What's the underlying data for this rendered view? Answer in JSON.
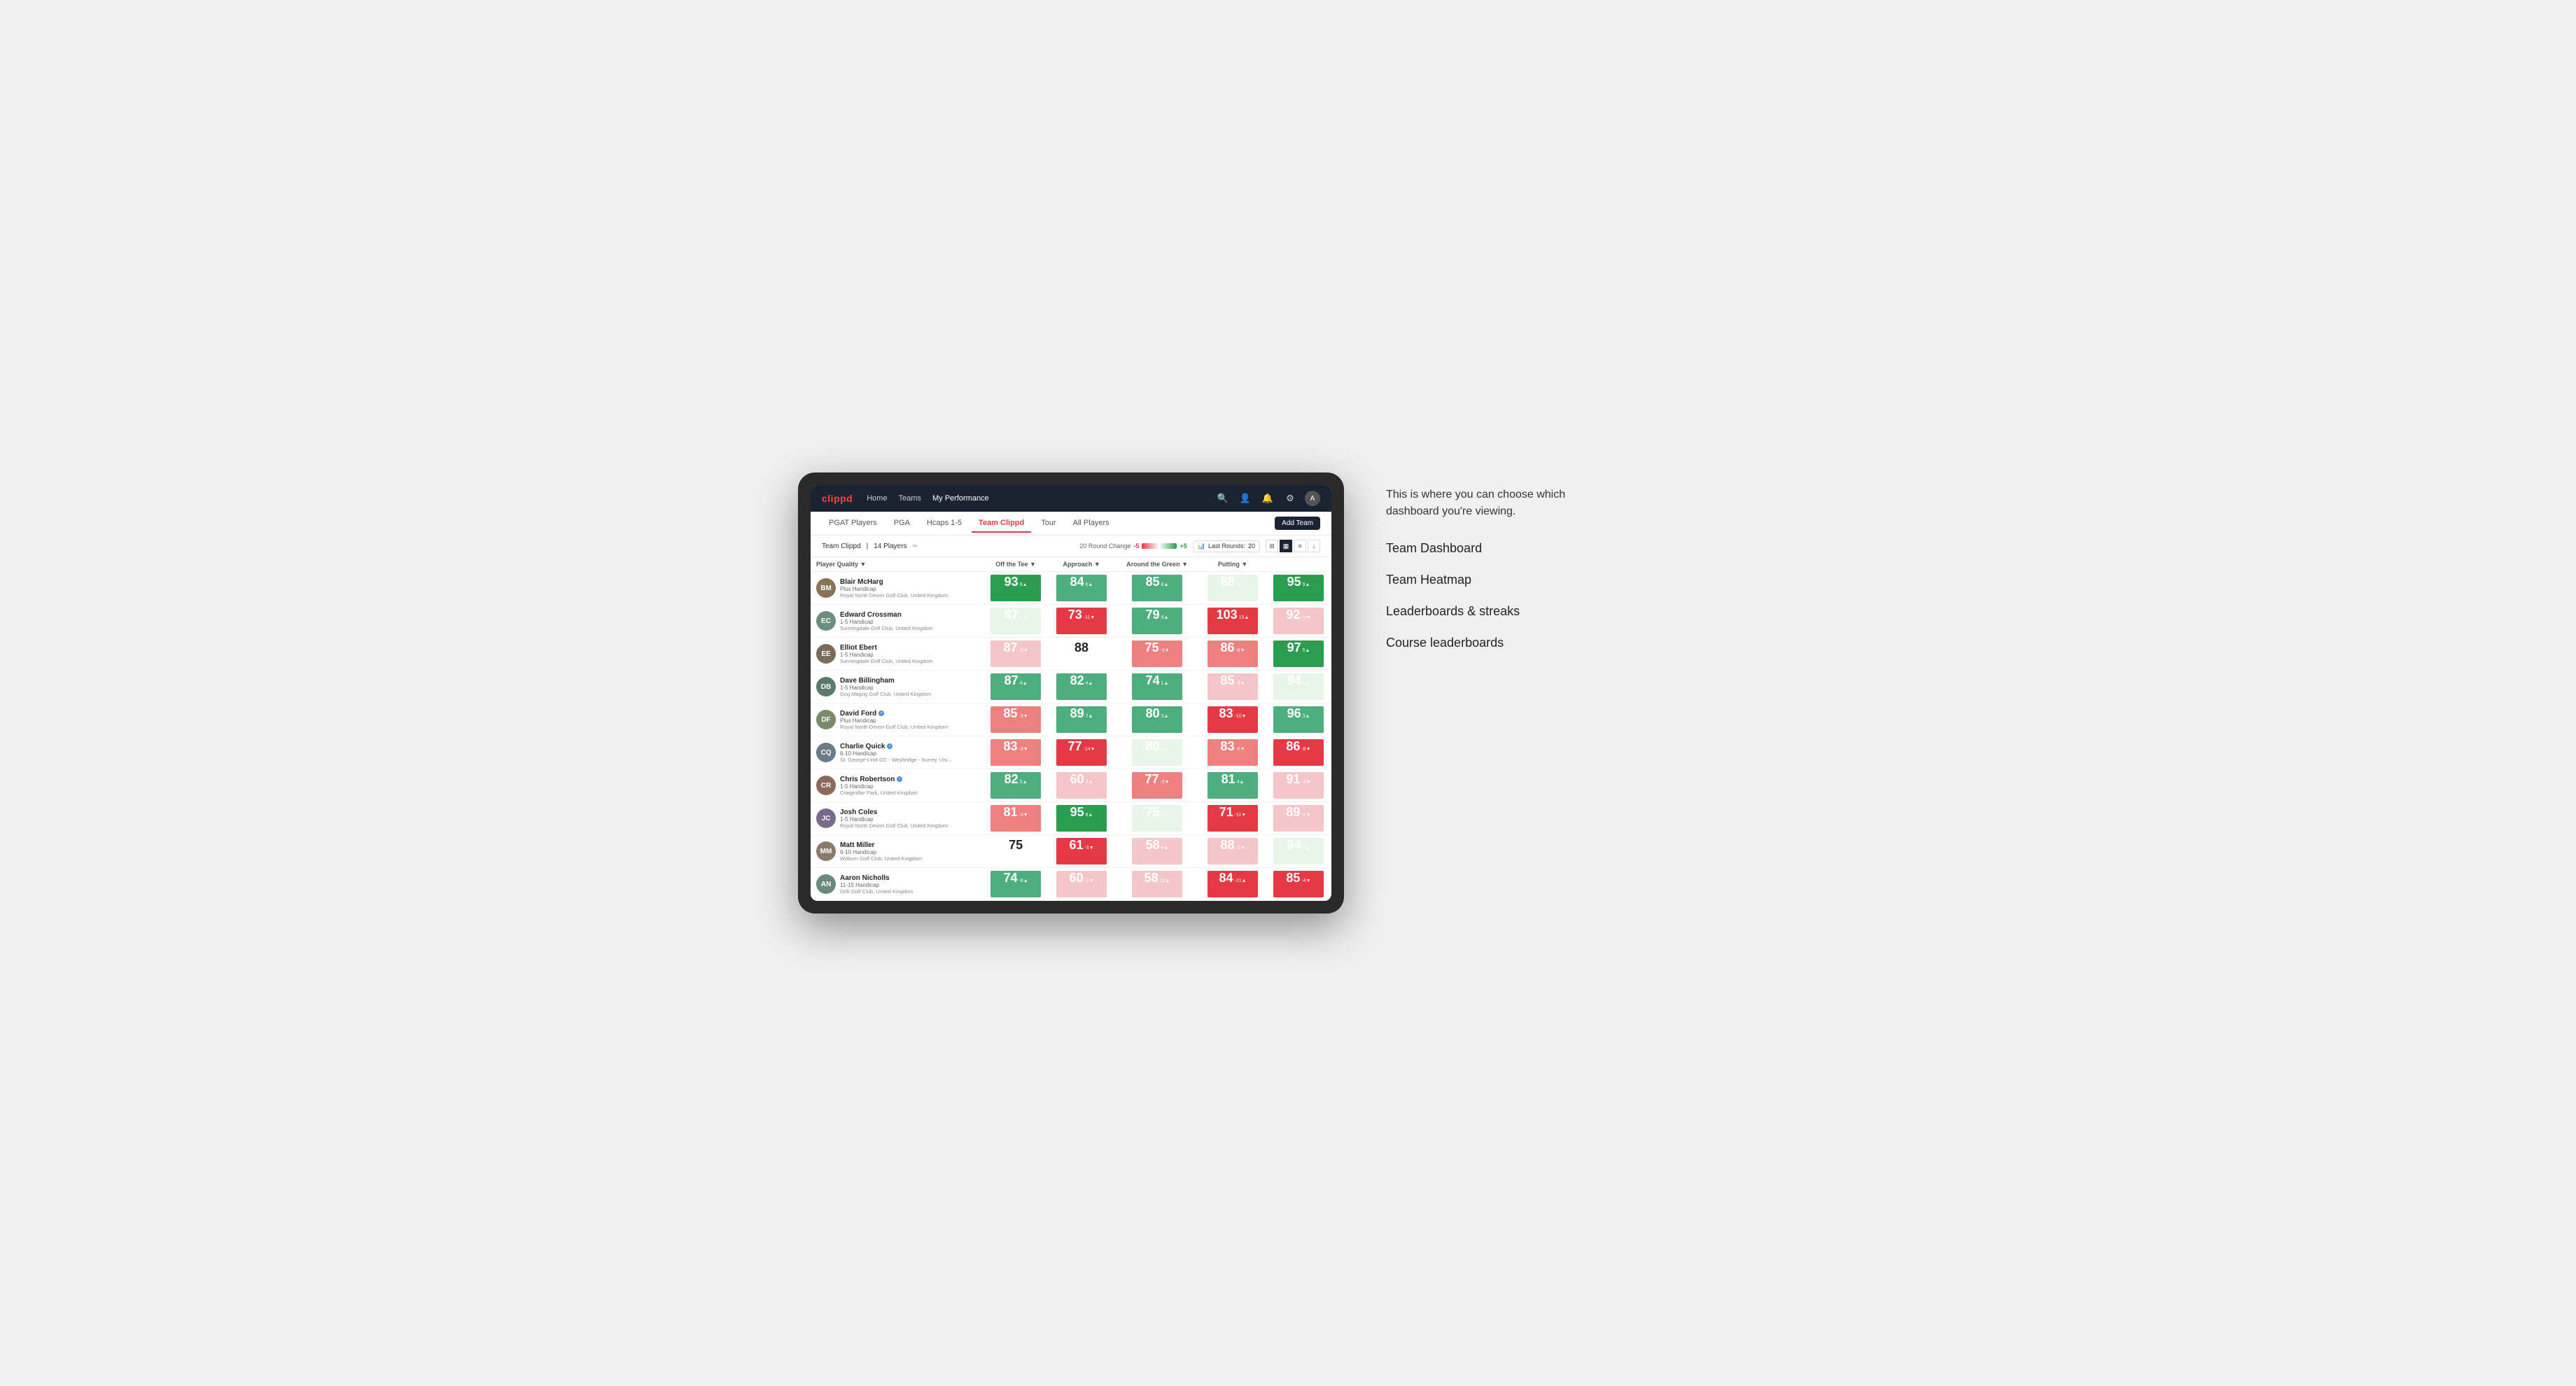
{
  "brand": "clippd",
  "navbar": {
    "links": [
      {
        "label": "Home",
        "active": false
      },
      {
        "label": "Teams",
        "active": false
      },
      {
        "label": "My Performance",
        "active": true
      }
    ],
    "icons": [
      "search",
      "person",
      "bell",
      "settings",
      "avatar"
    ]
  },
  "subnav": {
    "items": [
      {
        "label": "PGAT Players",
        "active": false
      },
      {
        "label": "PGA",
        "active": false
      },
      {
        "label": "Hcaps 1-5",
        "active": false
      },
      {
        "label": "Team Clippd",
        "active": true
      },
      {
        "label": "Tour",
        "active": false
      },
      {
        "label": "All Players",
        "active": false
      }
    ],
    "add_team_label": "Add Team"
  },
  "team_header": {
    "team_name": "Team Clippd",
    "separator": "|",
    "player_count": "14 Players",
    "round_change_label": "20 Round Change",
    "neg_value": "-5",
    "pos_value": "+5",
    "last_rounds_label": "Last Rounds:",
    "last_rounds_value": "20"
  },
  "table": {
    "columns": [
      {
        "label": "Player Quality ▼",
        "key": "quality"
      },
      {
        "label": "Off the Tee ▼",
        "key": "tee"
      },
      {
        "label": "Approach ▼",
        "key": "approach"
      },
      {
        "label": "Around the Green ▼",
        "key": "green"
      },
      {
        "label": "Putting ▼",
        "key": "putting"
      }
    ],
    "players": [
      {
        "name": "Blair McHarg",
        "handicap": "Plus Handicap",
        "club": "Royal North Devon Golf Club, United Kingdom",
        "initials": "BM",
        "avatar_color": "#8B7355",
        "quality": {
          "score": "93",
          "change": "9▲",
          "color": "#2a9d4e"
        },
        "tee": {
          "score": "84",
          "change": "6▲",
          "color": "#4caf7d"
        },
        "approach": {
          "score": "85",
          "change": "8▲",
          "color": "#4caf7d"
        },
        "green": {
          "score": "88",
          "change": "-1▼",
          "color": "#e8f5e9"
        },
        "putting": {
          "score": "95",
          "change": "9▲",
          "color": "#2a9d4e"
        }
      },
      {
        "name": "Edward Crossman",
        "handicap": "1-5 Handicap",
        "club": "Sunningdale Golf Club, United Kingdom",
        "initials": "EC",
        "avatar_color": "#6B8E7F",
        "quality": {
          "score": "87",
          "change": "1▲",
          "color": "#e8f5e9"
        },
        "tee": {
          "score": "73",
          "change": "-11▼",
          "color": "#e63946"
        },
        "approach": {
          "score": "79",
          "change": "9▲",
          "color": "#4caf7d"
        },
        "green": {
          "score": "103",
          "change": "15▲",
          "color": "#e63946"
        },
        "putting": {
          "score": "92",
          "change": "-3▼",
          "color": "#f5c6c8"
        }
      },
      {
        "name": "Elliot Ebert",
        "handicap": "1-5 Handicap",
        "club": "Sunningdale Golf Club, United Kingdom",
        "initials": "EE",
        "avatar_color": "#7B6B5A",
        "quality": {
          "score": "87",
          "change": "-3▼",
          "color": "#f5c6c8"
        },
        "tee": {
          "score": "88",
          "change": "",
          "color": "#fff"
        },
        "approach": {
          "score": "75",
          "change": "-3▼",
          "color": "#f08080"
        },
        "green": {
          "score": "86",
          "change": "-6▼",
          "color": "#f08080"
        },
        "putting": {
          "score": "97",
          "change": "5▲",
          "color": "#2a9d4e"
        }
      },
      {
        "name": "Dave Billingham",
        "handicap": "1-5 Handicap",
        "club": "Gog Magog Golf Club, United Kingdom",
        "initials": "DB",
        "avatar_color": "#5A7A6A",
        "quality": {
          "score": "87",
          "change": "4▲",
          "color": "#4caf7d"
        },
        "tee": {
          "score": "82",
          "change": "4▲",
          "color": "#4caf7d"
        },
        "approach": {
          "score": "74",
          "change": "1▲",
          "color": "#4caf7d"
        },
        "green": {
          "score": "85",
          "change": "-3▼",
          "color": "#f5c6c8"
        },
        "putting": {
          "score": "94",
          "change": "1▲",
          "color": "#e8f5e9"
        }
      },
      {
        "name": "David Ford",
        "handicap": "Plus Handicap",
        "club": "Royal North Devon Golf Club, United Kingdom",
        "initials": "DF",
        "avatar_color": "#7A8B6A",
        "verified": true,
        "quality": {
          "score": "85",
          "change": "-3▼",
          "color": "#f08080"
        },
        "tee": {
          "score": "89",
          "change": "7▲",
          "color": "#4caf7d"
        },
        "approach": {
          "score": "80",
          "change": "3▲",
          "color": "#4caf7d"
        },
        "green": {
          "score": "83",
          "change": "-10▼",
          "color": "#e63946"
        },
        "putting": {
          "score": "96",
          "change": "3▲",
          "color": "#4caf7d"
        }
      },
      {
        "name": "Charlie Quick",
        "handicap": "6-10 Handicap",
        "club": "St. George's Hill GC - Weybridge - Surrey, Uni...",
        "initials": "CQ",
        "avatar_color": "#6A7B8A",
        "verified": true,
        "quality": {
          "score": "83",
          "change": "-3▼",
          "color": "#f08080"
        },
        "tee": {
          "score": "77",
          "change": "-14▼",
          "color": "#e63946"
        },
        "approach": {
          "score": "80",
          "change": "1▲",
          "color": "#e8f5e9"
        },
        "green": {
          "score": "83",
          "change": "-6▼",
          "color": "#f08080"
        },
        "putting": {
          "score": "86",
          "change": "-8▼",
          "color": "#e63946"
        }
      },
      {
        "name": "Chris Robertson",
        "handicap": "1-5 Handicap",
        "club": "Craigmillar Park, United Kingdom",
        "initials": "CR",
        "avatar_color": "#8A6A5A",
        "verified": true,
        "quality": {
          "score": "82",
          "change": "3▲",
          "color": "#4caf7d"
        },
        "tee": {
          "score": "60",
          "change": "2▲",
          "color": "#f5c6c8"
        },
        "approach": {
          "score": "77",
          "change": "-3▼",
          "color": "#f08080"
        },
        "green": {
          "score": "81",
          "change": "4▲",
          "color": "#4caf7d"
        },
        "putting": {
          "score": "91",
          "change": "-3▼",
          "color": "#f5c6c8"
        }
      },
      {
        "name": "Josh Coles",
        "handicap": "1-5 Handicap",
        "club": "Royal North Devon Golf Club, United Kingdom",
        "initials": "JC",
        "avatar_color": "#7A6A8A",
        "quality": {
          "score": "81",
          "change": "-3▼",
          "color": "#f08080"
        },
        "tee": {
          "score": "95",
          "change": "8▲",
          "color": "#2a9d4e"
        },
        "approach": {
          "score": "75",
          "change": "2▲",
          "color": "#e8f5e9"
        },
        "green": {
          "score": "71",
          "change": "-11▼",
          "color": "#e63946"
        },
        "putting": {
          "score": "89",
          "change": "-2▼",
          "color": "#f5c6c8"
        }
      },
      {
        "name": "Matt Miller",
        "handicap": "6-10 Handicap",
        "club": "Woburn Golf Club, United Kingdom",
        "initials": "MM",
        "avatar_color": "#8A7A6A",
        "quality": {
          "score": "75",
          "change": "",
          "color": "#fff"
        },
        "tee": {
          "score": "61",
          "change": "-3▼",
          "color": "#e63946"
        },
        "approach": {
          "score": "58",
          "change": "4▲",
          "color": "#f5c6c8"
        },
        "green": {
          "score": "88",
          "change": "-2▼",
          "color": "#f5c6c8"
        },
        "putting": {
          "score": "94",
          "change": "3▲",
          "color": "#e8f5e9"
        }
      },
      {
        "name": "Aaron Nicholls",
        "handicap": "11-15 Handicap",
        "club": "Drift Golf Club, United Kingdom",
        "initials": "AN",
        "avatar_color": "#6A8A7A",
        "quality": {
          "score": "74",
          "change": "-8▲",
          "color": "#4caf7d"
        },
        "tee": {
          "score": "60",
          "change": "-1▼",
          "color": "#f5c6c8"
        },
        "approach": {
          "score": "58",
          "change": "10▲",
          "color": "#f5c6c8"
        },
        "green": {
          "score": "84",
          "change": "-21▲",
          "color": "#e63946"
        },
        "putting": {
          "score": "85",
          "change": "-4▼",
          "color": "#e63946"
        }
      }
    ]
  },
  "annotation": {
    "intro_text": "This is where you can choose which dashboard you're viewing.",
    "items": [
      "Team Dashboard",
      "Team Heatmap",
      "Leaderboards & streaks",
      "Course leaderboards"
    ]
  }
}
